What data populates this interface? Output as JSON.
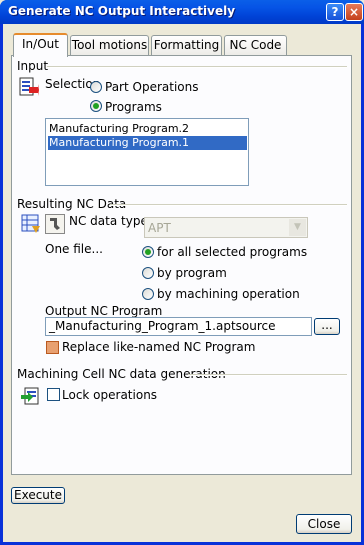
{
  "window": {
    "title": "Generate NC Output Interactively",
    "help_label": "?",
    "close_label": "×"
  },
  "tabs": [
    {
      "label": "In/Out",
      "active": true
    },
    {
      "label": "Tool motions"
    },
    {
      "label": "Formatting"
    },
    {
      "label": "NC Code"
    }
  ],
  "input": {
    "section_label": "Input",
    "selection_label": "Selection",
    "options": [
      {
        "label": "Part Operations",
        "checked": false
      },
      {
        "label": "Programs",
        "checked": true
      }
    ],
    "programs": [
      {
        "label": "Manufacturing Program.2",
        "selected": false
      },
      {
        "label": "Manufacturing Program.1",
        "selected": true
      }
    ]
  },
  "resulting": {
    "section_label": "Resulting NC Data",
    "nc_type_label": "NC data type:",
    "nc_type_value": "APT",
    "one_file_label": "One file...",
    "options": [
      {
        "label": "for all selected programs",
        "checked": true
      },
      {
        "label": "by program",
        "checked": false
      },
      {
        "label": "by machining operation",
        "checked": false
      }
    ],
    "output_label": "Output NC Program",
    "output_value": "_Manufacturing_Program_1.aptsource",
    "browse_label": "...",
    "replace_label": "Replace like-named NC Program",
    "replace_checked": true
  },
  "cell": {
    "section_label": "Machining Cell NC data generation",
    "lock_label": "Lock operations",
    "lock_checked": false
  },
  "actions": {
    "execute_label": "Execute",
    "close_label": "Close"
  }
}
